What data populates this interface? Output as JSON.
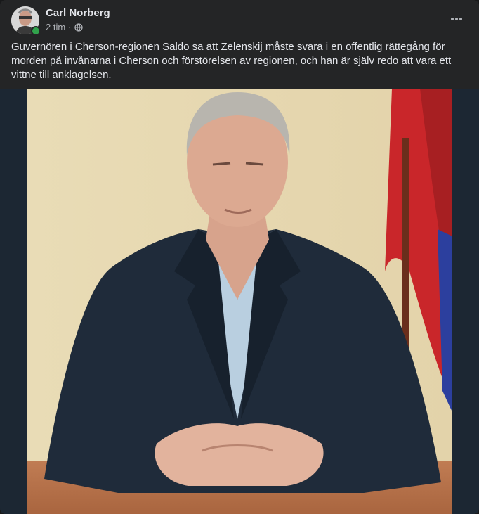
{
  "post": {
    "author": "Carl Norberg",
    "time": "2 tim",
    "separator": "·",
    "privacy_icon": "globe-icon",
    "menu_icon": "more-options-icon",
    "text": "Guvernören i Cherson-regionen Saldo sa att Zelenskij måste svara i en offentlig rättegång för morden på invånarna i Cherson och förstörelsen av regionen, och han är själv redo att vara ett vittne till anklagelsen."
  },
  "colors": {
    "card_bg": "#242526",
    "text_primary": "#e4e6eb",
    "text_secondary": "#b0b3b8",
    "online": "#31a24c",
    "media_bg": "#1c2733"
  }
}
